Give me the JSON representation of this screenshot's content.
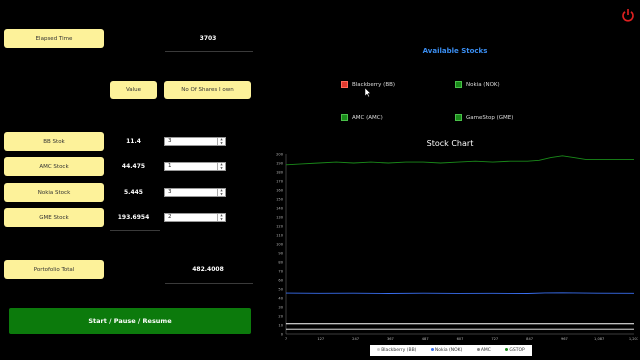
{
  "elapsed": {
    "label": "Elapsed Time",
    "value": "3703"
  },
  "columns": {
    "value": "Value",
    "shares": "No Of Shares I own"
  },
  "stocks": [
    {
      "label": "BB Stok",
      "value": "11.4",
      "shares": "3"
    },
    {
      "label": "AMC Stock",
      "value": "44.475",
      "shares": "1"
    },
    {
      "label": "Nokia Stock",
      "value": "5.445",
      "shares": "3"
    },
    {
      "label": "GME Stock",
      "value": "193.6954",
      "shares": "2"
    }
  ],
  "portfolio": {
    "label": "Portofolio Total",
    "value": "482.4008"
  },
  "start_button": "Start / Pause / Resume",
  "available": {
    "title": "Available Stocks",
    "items": [
      {
        "label": "Blackberry (BB)",
        "color": "#e03a2f"
      },
      {
        "label": "Nokia (NOK)",
        "color": "#1a8a1a"
      },
      {
        "label": "AMC (AMC)",
        "color": "#1a8a1a"
      },
      {
        "label": "GameStop (GME)",
        "color": "#1a8a1a"
      }
    ]
  },
  "power_icon": "power-icon",
  "chart_data": {
    "type": "line",
    "title": "Stock Chart",
    "x_ticks": [
      "7",
      "127",
      "247",
      "367",
      "487",
      "607",
      "727",
      "847",
      "967",
      "1,087",
      "1,207"
    ],
    "y_ticks": [
      "0",
      "10",
      "20",
      "30",
      "40",
      "50",
      "60",
      "70",
      "80",
      "90",
      "100",
      "110",
      "120",
      "130",
      "140",
      "150",
      "160",
      "170",
      "180",
      "190",
      "200"
    ],
    "xlim": [
      7,
      1207
    ],
    "ylim": [
      0,
      200
    ],
    "series": [
      {
        "name": "Blackberry (BB)",
        "color": "#ffffff",
        "x": [
          7,
          1207
        ],
        "y": [
          11.4,
          11.4
        ]
      },
      {
        "name": "Nokia (NOK)",
        "color": "#3a6ff0",
        "x": [
          7,
          120,
          240,
          360,
          480,
          600,
          720,
          840,
          900,
          960,
          1080,
          1207
        ],
        "y": [
          45.5,
          45.2,
          45.4,
          45.0,
          45.3,
          45.1,
          45.2,
          45.0,
          45.6,
          45.8,
          45.3,
          45.2
        ]
      },
      {
        "name": "AMC",
        "color": "#ffffff",
        "x": [
          7,
          1207
        ],
        "y": [
          5.4,
          5.4
        ]
      },
      {
        "name": "GSTOP",
        "color": "#1a8a1a",
        "x": [
          7,
          60,
          120,
          180,
          240,
          300,
          360,
          420,
          480,
          540,
          600,
          660,
          720,
          780,
          840,
          880,
          920,
          960,
          1000,
          1040,
          1080,
          1140,
          1207
        ],
        "y": [
          188,
          189,
          190,
          191,
          190,
          191,
          190,
          191,
          191,
          190,
          191,
          192,
          191,
          192,
          192,
          193,
          196,
          198,
          196,
          194,
          194,
          194,
          194
        ]
      }
    ],
    "legend": [
      "Blackberry (BB)",
      "Nokia (NOK)",
      "AMC",
      "GSTOP"
    ]
  }
}
